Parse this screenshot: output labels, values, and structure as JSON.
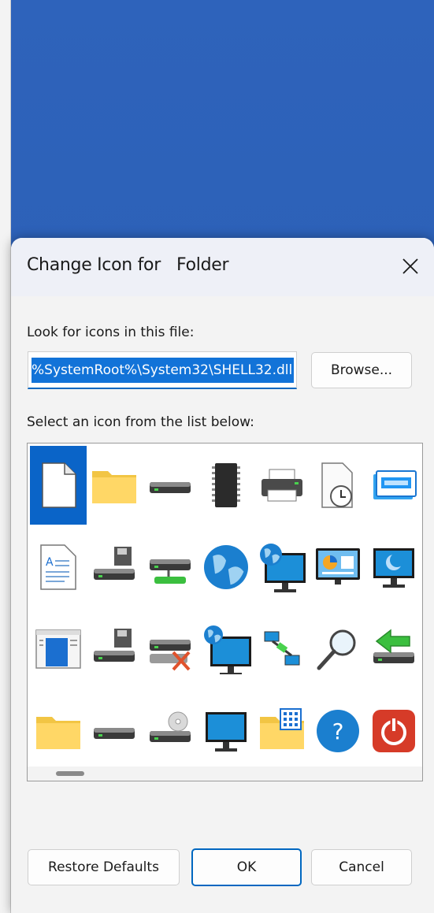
{
  "dialog": {
    "title": "Change Icon for   Folder",
    "close_icon": "close-icon",
    "file_label": "Look for icons in this file:",
    "file_value": "%SystemRoot%\\System32\\SHELL32.dll",
    "browse_label": "Browse...",
    "list_label": "Select an icon from the list below:",
    "icons": [
      [
        "blank-document-icon",
        "folder-icon",
        "drive-icon",
        "chip-icon",
        "printer-icon",
        "document-clock-icon",
        "window-stack-icon"
      ],
      [
        "text-document-icon",
        "floppy-drive-icon",
        "drive-network-icon",
        "globe-icon",
        "globe-monitor-icon",
        "control-panel-icon",
        "sleep-monitor-icon"
      ],
      [
        "app-window-icon",
        "floppy-drive-icon",
        "drive-disconnected-icon",
        "network-monitor-icon",
        "network-link-icon",
        "magnifier-icon",
        "green-arrow-drive-icon"
      ],
      [
        "folder-icon",
        "drive-icon",
        "cd-drive-icon",
        "monitor-icon",
        "folder-apps-icon",
        "help-icon",
        "power-icon"
      ]
    ],
    "selected_icon_index": 0,
    "restore_label": "Restore Defaults",
    "ok_label": "OK",
    "cancel_label": "Cancel"
  }
}
